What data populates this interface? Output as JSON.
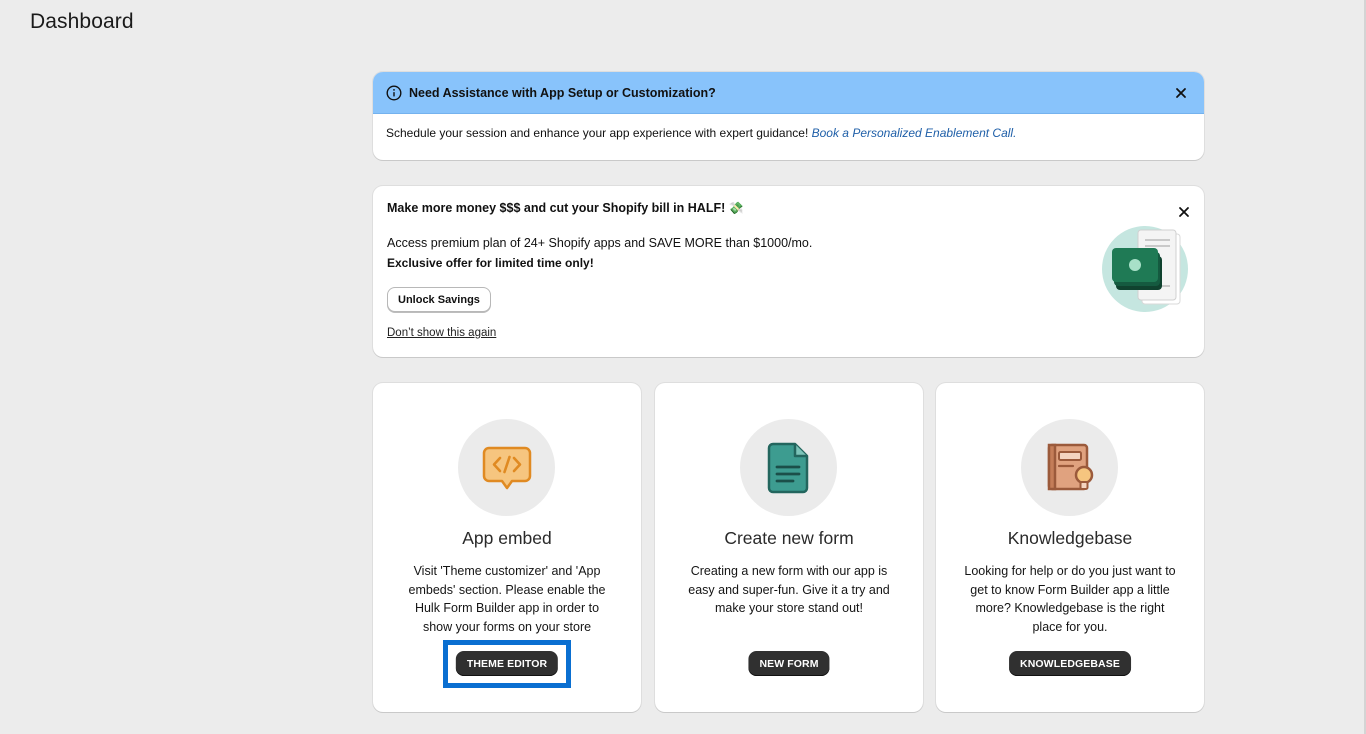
{
  "page": {
    "title": "Dashboard"
  },
  "assist_banner": {
    "title": "Need Assistance with App Setup or Customization?",
    "body_text": "Schedule your session and enhance your app experience with expert guidance!",
    "link_text": "Book a Personalized Enablement Call."
  },
  "promo": {
    "heading": "Make more money $$$ and cut your Shopify bill in HALF!",
    "heading_emoji": "💸",
    "description": "Access premium plan of 24+ Shopify apps and SAVE MORE than $1000/mo.",
    "offer": "Exclusive offer for limited time only!",
    "unlock_label": "Unlock Savings",
    "dont_show_label": "Don’t show this again"
  },
  "cards": [
    {
      "title": "App embed",
      "text": "Visit 'Theme customizer' and 'App embeds' section. Please enable the Hulk Form Builder app in order to show your forms on your store",
      "button": "THEME EDITOR",
      "icon": "code-chat-icon"
    },
    {
      "title": "Create new form",
      "text": "Creating a new form with our app is easy and super-fun. Give it a try and make your store stand out!",
      "button": "NEW FORM",
      "icon": "document-icon"
    },
    {
      "title": "Knowledgebase",
      "text": "Looking for help or do you just want to get to know Form Builder app a little more? Knowledgebase is the right place for you.",
      "button": "KNOWLEDGEBASE",
      "icon": "book-bulb-icon"
    }
  ],
  "colors": {
    "banner_blue": "#88c3fb",
    "primary_button": "#303030",
    "highlight": "#0a6fd1",
    "link": "#1f5fa8",
    "code_icon": "#e8962f",
    "doc_icon": "#2f8a80",
    "book_icon": "#c47d58"
  }
}
